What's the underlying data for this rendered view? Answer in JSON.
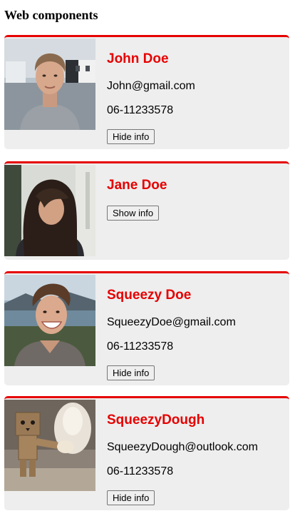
{
  "page": {
    "title": "Web components"
  },
  "cards": [
    {
      "name": "John Doe",
      "email": "John@gmail.com",
      "phone": "06-11233578",
      "button_label": "Hide info",
      "photo_icon": "person-photo"
    },
    {
      "name": "Jane Doe",
      "button_label": "Show info",
      "photo_icon": "person-photo"
    },
    {
      "name": "Squeezy Doe",
      "email": "SqueezyDoe@gmail.com",
      "phone": "06-11233578",
      "button_label": "Hide info",
      "photo_icon": "person-photo"
    },
    {
      "name": "SqueezyDough",
      "email": "SqueezyDough@outlook.com",
      "phone": "06-11233578",
      "button_label": "Hide info",
      "photo_icon": "danbo-figure-photo"
    }
  ],
  "colors": {
    "accent": "#e60000",
    "card_background": "#eeeeee"
  }
}
